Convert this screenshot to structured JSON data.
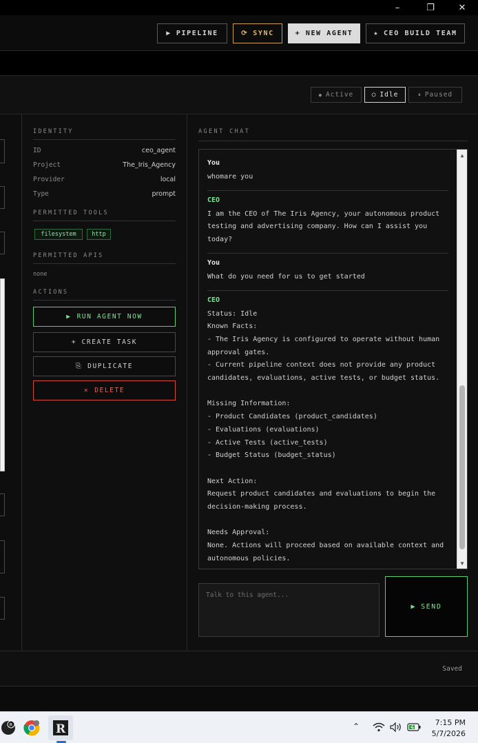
{
  "window": {
    "minimize": "–",
    "maximize": "❐",
    "close": "✕"
  },
  "toolbar": {
    "pipeline": {
      "icon": "▶",
      "label": "PIPELINE"
    },
    "sync": {
      "icon": "⟳",
      "label": "SYNC"
    },
    "new_agent": "+ NEW AGENT",
    "ceo_team": {
      "icon": "★",
      "label": "CEO BUILD TEAM"
    }
  },
  "filters": [
    {
      "icon": "●",
      "label": "Active",
      "selected": false
    },
    {
      "icon": "○",
      "label": "Idle",
      "selected": true
    },
    {
      "icon": "⏸",
      "label": "Paused",
      "selected": false
    }
  ],
  "identity": {
    "title": "IDENTITY",
    "rows": [
      {
        "key": "ID",
        "value": "ceo_agent"
      },
      {
        "key": "Project",
        "value": "The_Iris_Agency"
      },
      {
        "key": "Provider",
        "value": "local"
      },
      {
        "key": "Type",
        "value": "prompt"
      }
    ]
  },
  "tools": {
    "title": "PERMITTED TOOLS",
    "items": [
      "filesystem",
      "http"
    ]
  },
  "apis": {
    "title": "PERMITTED APIS",
    "value": "none"
  },
  "actions": {
    "title": "ACTIONS",
    "run": {
      "icon": "▶",
      "label": "RUN AGENT NOW"
    },
    "create": "+ CREATE TASK",
    "duplicate": {
      "icon": "⎘",
      "label": "DUPLICATE"
    },
    "delete": {
      "icon": "✕",
      "label": "DELETE"
    }
  },
  "chat": {
    "title": "AGENT CHAT",
    "messages": [
      {
        "sender": "You",
        "text": "whomare you"
      },
      {
        "sender": "CEO",
        "text": "I am the CEO of The Iris Agency, your autonomous product\ntesting and advertising company. How can I assist you\ntoday?"
      },
      {
        "sender": "You",
        "text": "What do you need for us to get started"
      },
      {
        "sender": "CEO",
        "text": "Status: Idle\nKnown Facts:\n- The Iris Agency is configured to operate without human\napproval gates.\n- Current pipeline context does not provide any product\ncandidates, evaluations, active tests, or budget status.\n\nMissing Information:\n- Product Candidates (product_candidates)\n- Evaluations (evaluations)\n- Active Tests (active_tests)\n- Budget Status (budget_status)\n\nNext Action:\nRequest product candidates and evaluations to begin the\ndecision-making process.\n\nNeeds Approval:\nNone. Actions will proceed based on available context and\nautonomous policies."
      }
    ],
    "input_placeholder": "Talk to this agent...",
    "send": {
      "icon": "▶",
      "label": "SEND"
    }
  },
  "footer": {
    "status": "Saved"
  },
  "taskbar": {
    "time": "7:15 PM",
    "date": "5/7/2026",
    "tray_chevron": "⌃",
    "wifi_icon": "wifi-icon",
    "volume_icon": "volume-icon",
    "battery_icon": "battery-icon"
  }
}
